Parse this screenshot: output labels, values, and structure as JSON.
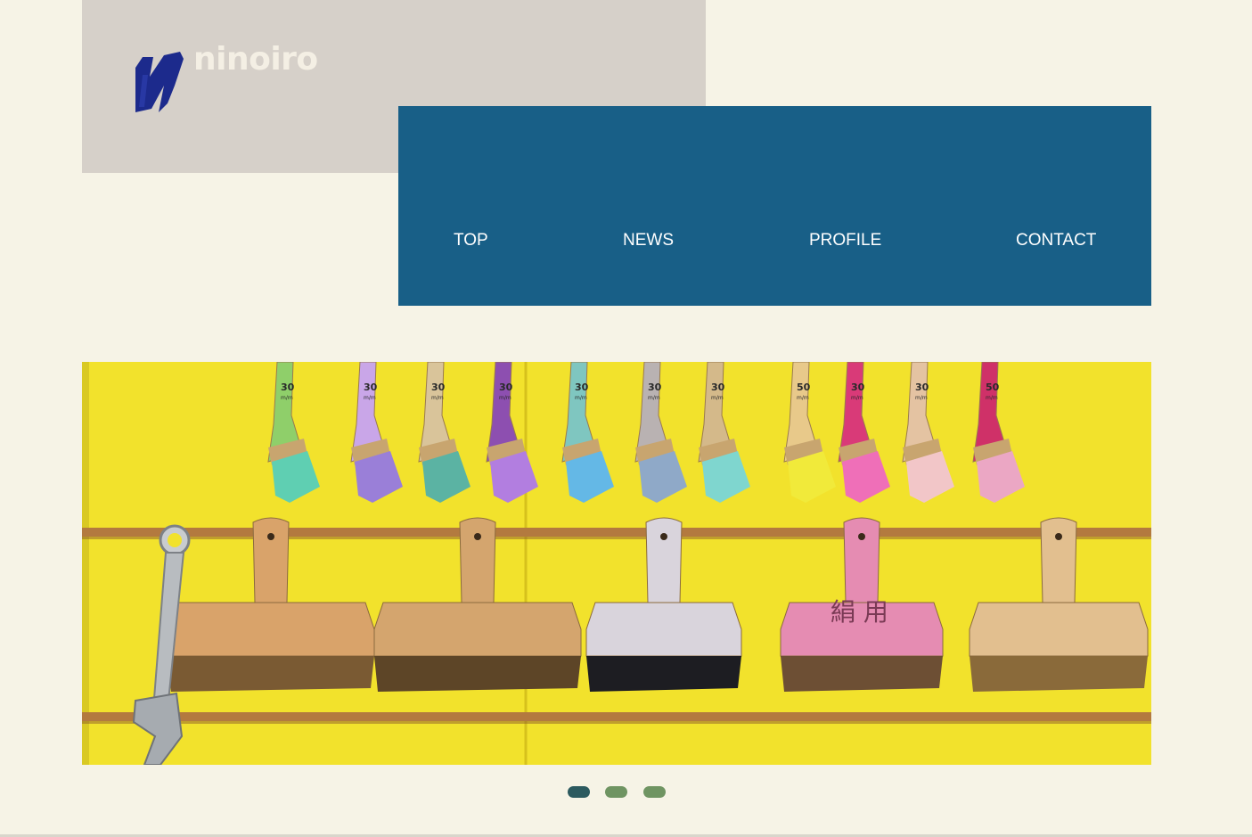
{
  "brand": {
    "name": "ninoiro",
    "logo_icon": "n-mark-icon",
    "mark_color": "#1c2a8c"
  },
  "nav": {
    "items": [
      {
        "label": "TOP"
      },
      {
        "label": "NEWS"
      },
      {
        "label": "PROFILE"
      },
      {
        "label": "CONTACT"
      }
    ],
    "background": "#185f87"
  },
  "hero": {
    "image": "paint-brushes-on-yellow-wall",
    "brush_labels": [
      "30",
      "30",
      "30",
      "30",
      "30",
      "30",
      "30",
      "50",
      "30",
      "30",
      "50"
    ],
    "brush_unit": "m/m",
    "board_text": "絹 用"
  },
  "slider": {
    "slide_count": 3,
    "active_index": 0,
    "active_color": "#2c5a5f",
    "inactive_color": "#6f9462"
  },
  "colors": {
    "page_bg": "#f6f3e6",
    "logo_panel": "#d6d0c9"
  }
}
